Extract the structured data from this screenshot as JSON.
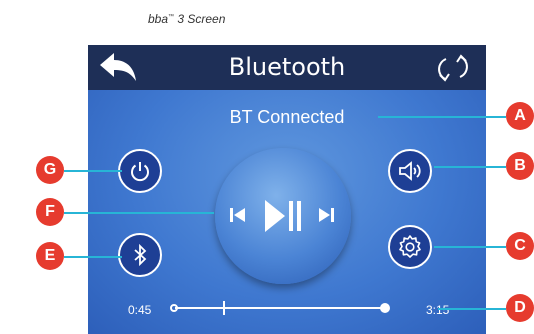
{
  "caption": {
    "brand": "bba",
    "tm": "™",
    "rest": " 3 Screen"
  },
  "screen": {
    "title": "Bluetooth",
    "status": "BT Connected",
    "time_elapsed": "0:45",
    "time_total": "3:15",
    "progress_fraction": 0.23,
    "icons": {
      "back": "back-arrow-icon",
      "refresh": "refresh-icon",
      "power": "power-icon",
      "bluetooth": "bluetooth-icon",
      "volume": "speaker-volume-icon",
      "settings": "gear-icon",
      "previous": "skip-previous-icon",
      "play_pause": "play-pause-icon",
      "next": "skip-next-icon"
    }
  },
  "callouts": {
    "a": "A",
    "b": "B",
    "c": "C",
    "d": "D",
    "e": "E",
    "f": "F",
    "g": "G"
  },
  "colors": {
    "titlebar": "#1e2f57",
    "screen_bg": "#3f78d0",
    "button_bg": "#1e3f95",
    "callout": "#e63b2e",
    "leader_line": "#27b5d6"
  }
}
